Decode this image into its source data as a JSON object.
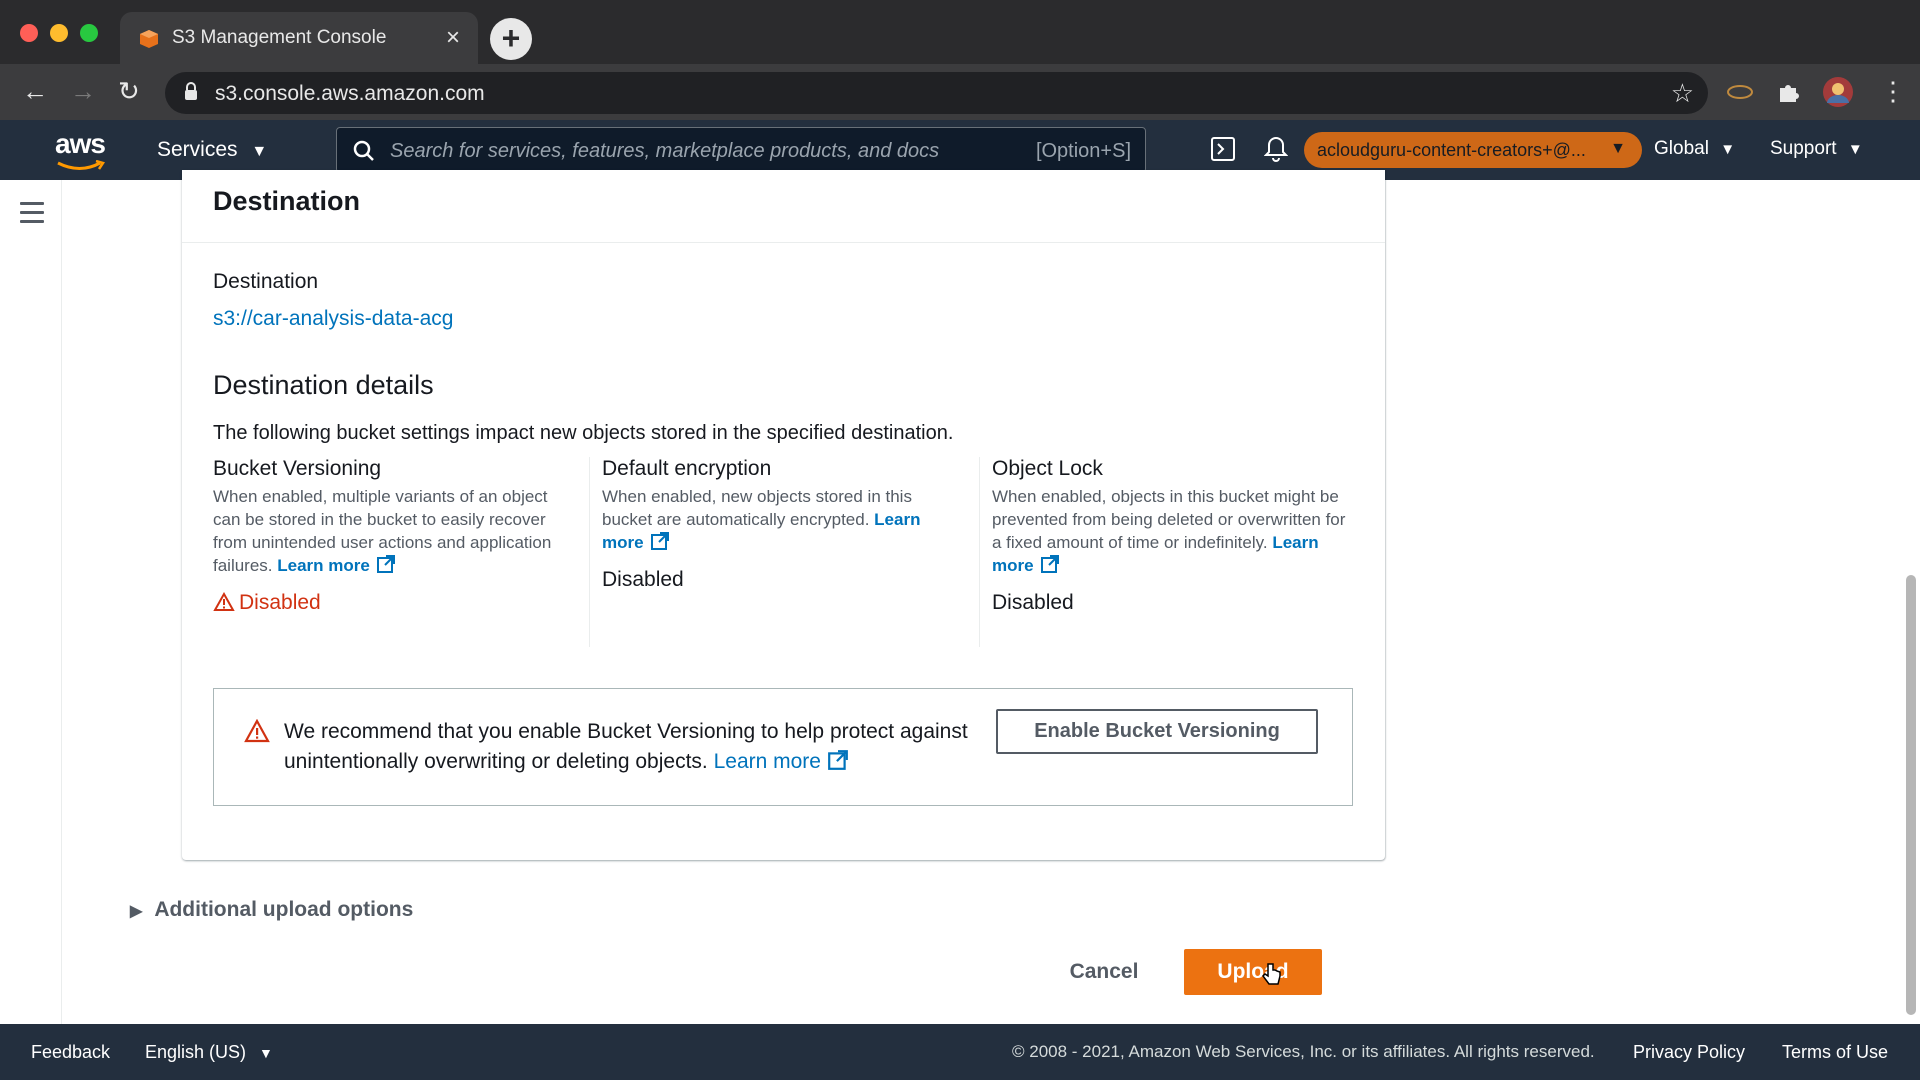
{
  "browser": {
    "tab_title": "S3 Management Console",
    "url": "s3.console.aws.amazon.com"
  },
  "aws_nav": {
    "logo": "aws",
    "services_label": "Services",
    "search_placeholder": "Search for services, features, marketplace products, and docs",
    "search_shortcut": "[Option+S]",
    "account_label": "acloudguru-content-creators+@...",
    "region_label": "Global",
    "support_label": "Support"
  },
  "destination": {
    "panel_title": "Destination",
    "field_label": "Destination",
    "bucket_link": "s3://car-analysis-data-acg",
    "details_title": "Destination details",
    "details_description": "The following bucket settings impact new objects stored in the specified destination."
  },
  "settings": {
    "versioning": {
      "title": "Bucket Versioning",
      "description": "When enabled, multiple variants of an object can be stored in the bucket to easily recover from unintended user actions and application failures.",
      "learn_more": "Learn more",
      "status": "Disabled"
    },
    "encryption": {
      "title": "Default encryption",
      "description": "When enabled, new objects stored in this bucket are automatically encrypted.",
      "learn_more": "Learn more",
      "status": "Disabled"
    },
    "object_lock": {
      "title": "Object Lock",
      "description": "When enabled, objects in this bucket might be prevented from being deleted or overwritten for a fixed amount of time or indefinitely.",
      "learn_more": "Learn more",
      "status": "Disabled"
    }
  },
  "alert": {
    "text": "We recommend that you enable Bucket Versioning to help protect against unintentionally overwriting or deleting objects.",
    "learn_more": "Learn more",
    "button_label": "Enable Bucket Versioning"
  },
  "additional_options_label": "Additional upload options",
  "actions": {
    "cancel_label": "Cancel",
    "upload_label": "Upload"
  },
  "footer": {
    "feedback": "Feedback",
    "language": "English (US)",
    "copyright": "© 2008 - 2021, Amazon Web Services, Inc. or its affiliates. All rights reserved.",
    "privacy": "Privacy Policy",
    "terms": "Terms of Use"
  },
  "colors": {
    "aws_nav": "#232f3e",
    "accent_orange": "#ec7211",
    "link_blue": "#0073bb",
    "error_red": "#d13212"
  }
}
